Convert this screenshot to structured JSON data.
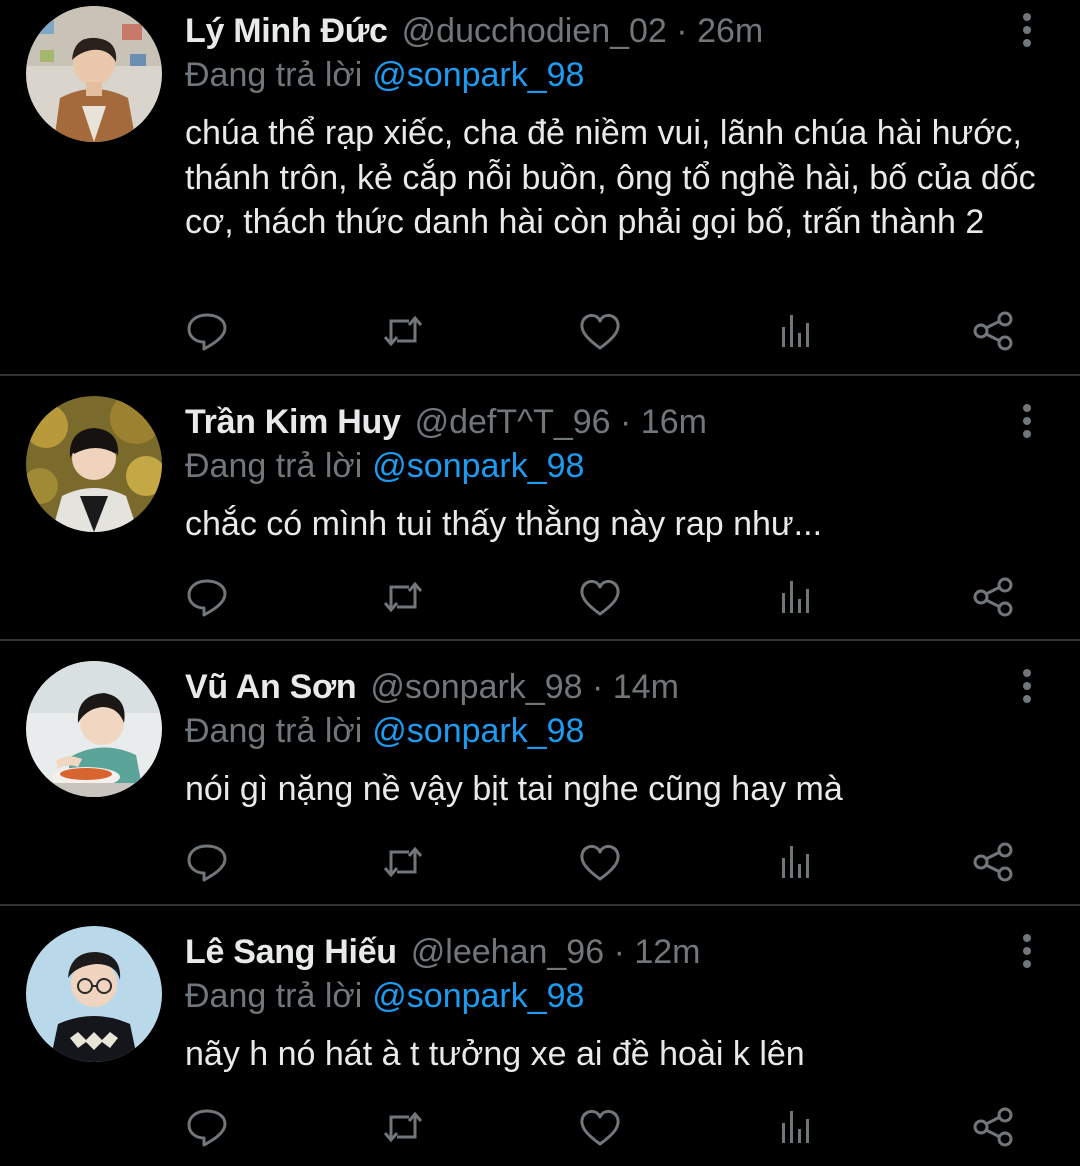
{
  "theme": {
    "background": "#000000",
    "text": "#e7e9ea",
    "muted": "#71767b",
    "accent": "#1d9bf0",
    "divider": "#2f3336"
  },
  "reply_prefix": "Đang trả lời",
  "tweets": [
    {
      "name": "Lý Minh Đức",
      "handle": "@ducchodien_02",
      "separator": "·",
      "time": "26m",
      "reply_to": "@sonpark_98",
      "text": "chúa thể rạp xiếc, cha đẻ niềm vui, lãnh chúa hài hước, thánh trôn, kẻ cắp nỗi buồn, ông tổ nghề hài, bố của dốc cơ, thách thức danh hài còn phải gọi bố, trấn thành 2",
      "avatar_icon": "profile-photo"
    },
    {
      "name": "Trần Kim Huy",
      "handle": "@defT^T_96",
      "separator": "·",
      "time": "16m",
      "reply_to": "@sonpark_98",
      "text": "chắc có mình tui thấy thằng này rap như...",
      "avatar_icon": "profile-photo"
    },
    {
      "name": "Vũ An Sơn",
      "handle": "@sonpark_98",
      "separator": "·",
      "time": "14m",
      "reply_to": "@sonpark_98",
      "text": "nói gì nặng nề vậy bịt tai nghe cũng hay mà",
      "avatar_icon": "profile-photo"
    },
    {
      "name": "Lê Sang Hiếu",
      "handle": "@leehan_96",
      "separator": "·",
      "time": "12m",
      "reply_to": "@sonpark_98",
      "text": "nãy h nó hát à t tưởng xe ai đề hoài k lên",
      "avatar_icon": "profile-photo"
    }
  ],
  "action_icons": [
    "reply-icon",
    "retweet-icon",
    "like-icon",
    "analytics-icon",
    "share-icon"
  ]
}
